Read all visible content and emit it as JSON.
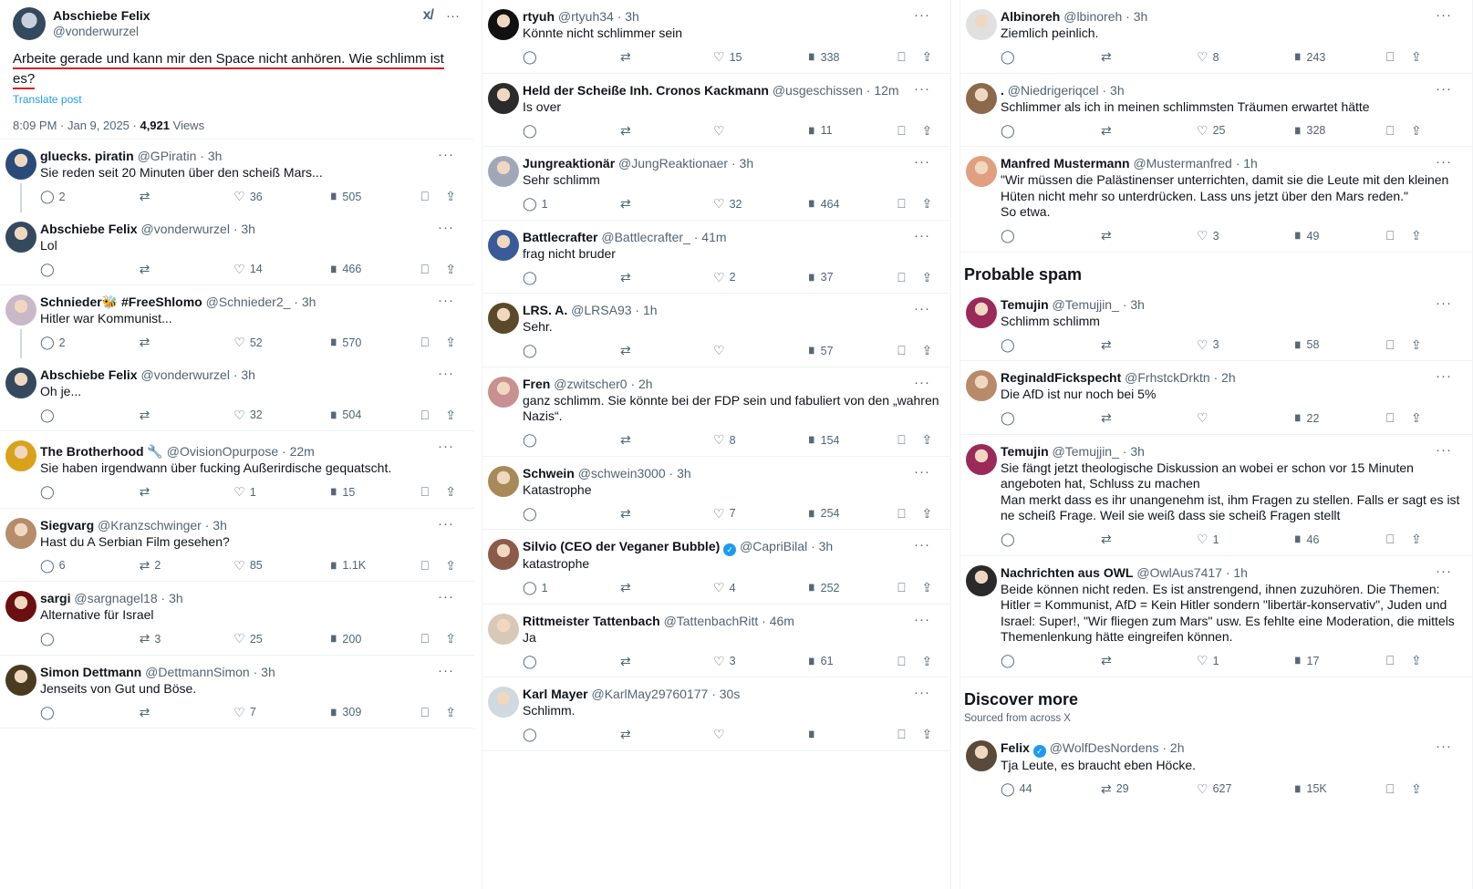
{
  "main_post": {
    "name": "Abschiebe Felix",
    "handle": "@vonderwurzel",
    "text": "Arbeite gerade und kann mir den Space nicht anhören. Wie schlimm ist es?",
    "translate": "Translate post",
    "time": "8:09 PM · Jan 9, 2025 · ",
    "views": "4,921",
    "views_label": " Views",
    "grok_icon": "x-ai-icon",
    "more_icon": "more-dots-icon"
  },
  "columns": [
    [
      {
        "name": "gluecks. piratin",
        "handle": "@GPiratin · 3h",
        "text": "Sie reden seit 20 Minuten über den scheiß Mars...",
        "replies": "2",
        "reposts": "",
        "likes": "36",
        "views": "505",
        "color": "#2a4a7a",
        "thread": "start"
      },
      {
        "name": "Abschiebe Felix",
        "handle": "@vonderwurzel · 3h",
        "text": "Lol",
        "replies": "",
        "reposts": "",
        "likes": "14",
        "views": "466",
        "color": "#34495e",
        "thread": "end",
        "sep": true
      },
      {
        "name": "Schnieder🐝 #FreeShlomo",
        "handle": "@Schnieder2_ · 3h",
        "text": "Hitler war Kommunist...",
        "replies": "2",
        "reposts": "",
        "likes": "52",
        "views": "570",
        "color": "#c8b8c8",
        "thread": "start"
      },
      {
        "name": "Abschiebe Felix",
        "handle": "@vonderwurzel · 3h",
        "text": "Oh je...",
        "replies": "",
        "reposts": "",
        "likes": "32",
        "views": "504",
        "color": "#34495e",
        "thread": "end",
        "sep": true
      },
      {
        "name": "The Brotherhood 🔧",
        "handle": "@OvisionOpurpose · 22m",
        "text": "Sie haben irgendwann über fucking Außerirdische gequatscht.",
        "replies": "",
        "reposts": "",
        "likes": "1",
        "views": "15",
        "color": "#d9a21b",
        "sep": true,
        "pad": 40
      },
      {
        "name": "Siegvarg",
        "handle": "@Kranzschwinger · 3h",
        "text": "Hast du A Serbian Film gesehen?",
        "replies": "6",
        "reposts": "2",
        "likes": "85",
        "views": "1.1K",
        "color": "#b58c6c",
        "sep": true
      },
      {
        "name": "sargi",
        "handle": "@sargnagel18 · 3h",
        "text": "Alternative für Israel",
        "replies": "",
        "reposts": "3",
        "likes": "25",
        "views": "200",
        "color": "#6a1010",
        "sep": true
      },
      {
        "name": "Simon Dettmann",
        "handle": "@DettmannSimon · 3h",
        "text": "Jenseits von Gut und Böse.",
        "replies": "",
        "reposts": "",
        "likes": "7",
        "views": "309",
        "color": "#4a3a20",
        "sep": true
      }
    ],
    [
      {
        "name": "rtyuh",
        "handle": "@rtyuh34 · 3h",
        "text": "Könnte nicht schlimmer sein",
        "replies": "",
        "reposts": "",
        "likes": "15",
        "views": "338",
        "color": "#111111",
        "sep": true
      },
      {
        "name": "Held der Scheiße Inh. Cronos Kackmann",
        "handle": "@usgeschissen · 12m",
        "text": "Is over",
        "replies": "",
        "reposts": "",
        "likes": "",
        "views": "11",
        "color": "#2b2b2b",
        "sep": true
      },
      {
        "name": "Jungreaktionär",
        "handle": "@JungReaktionaer · 3h",
        "text": "Sehr schlimm",
        "replies": "1",
        "reposts": "",
        "likes": "32",
        "views": "464",
        "color": "#a0a8b8",
        "sep": true
      },
      {
        "name": "Battlecrafter",
        "handle": "@Battlecrafter_ · 41m",
        "text": "frag nicht bruder",
        "replies": "",
        "reposts": "",
        "likes": "2",
        "views": "37",
        "color": "#3a5a9a",
        "sep": true
      },
      {
        "name": "LRS. A.",
        "handle": "@LRSA93 · 1h",
        "text": "Sehr.",
        "replies": "",
        "reposts": "",
        "likes": "",
        "views": "57",
        "color": "#5a4a2a",
        "sep": true
      },
      {
        "name": "Fren",
        "handle": "@zwitscher0 · 2h",
        "text": "ganz schlimm. Sie könnte bei der FDP sein und fabuliert von den „wahren Nazis“.",
        "replies": "",
        "reposts": "",
        "likes": "8",
        "views": "154",
        "color": "#c89090",
        "sep": true
      },
      {
        "name": "Schwein",
        "handle": "@schwein3000 · 3h",
        "text": "Katastrophe",
        "replies": "",
        "reposts": "",
        "likes": "7",
        "views": "254",
        "color": "#a88a5a",
        "sep": true
      },
      {
        "name": "Silvio (CEO der Veganer Bubble)",
        "handle": "@CapriBilal · 3h",
        "text": "katastrophe",
        "replies": "1",
        "reposts": "",
        "likes": "4",
        "views": "252",
        "color": "#8a5a4a",
        "verified": true,
        "sep": true
      },
      {
        "name": "Rittmeister Tattenbach",
        "handle": "@TattenbachRitt · 46m",
        "text": "Ja",
        "replies": "",
        "reposts": "",
        "likes": "3",
        "views": "61",
        "color": "#d8c8b8",
        "sep": true
      },
      {
        "name": "Karl Mayer",
        "handle": "@KarlMay29760177 · 30s",
        "text": "Schlimm.",
        "replies": "",
        "reposts": "",
        "likes": "",
        "views": "",
        "color": "#d0d8e0",
        "sep": true
      }
    ],
    [
      {
        "name": "Albinoreh",
        "handle": "@lbinoreh · 3h",
        "text": "Ziemlich peinlich.",
        "replies": "",
        "reposts": "",
        "likes": "8",
        "views": "243",
        "color": "#e0e0e0",
        "sep": true
      },
      {
        "name": ".",
        "handle": "@Niedrigeriqcel · 3h",
        "text": "Schlimmer als ich in meinen schlimmsten Träumen erwartet hätte",
        "replies": "",
        "reposts": "",
        "likes": "25",
        "views": "328",
        "color": "#8a6a4a",
        "sep": true
      },
      {
        "name": "Manfred Mustermann",
        "handle": "@Mustermanfred · 1h",
        "text": "\"Wir müssen die Palästinenser unterrichten, damit sie die Leute mit den kleinen Hüten nicht mehr so unterdrücken. Lass uns jetzt über den Mars reden.\"\nSo etwa.",
        "replies": "",
        "reposts": "",
        "likes": "3",
        "views": "49",
        "color": "#e0a080",
        "sep": true
      },
      {
        "section": "Probable spam"
      },
      {
        "name": "Temujin",
        "handle": "@Temujjin_ · 3h",
        "text": "Schlimm schlimm",
        "replies": "",
        "reposts": "",
        "likes": "3",
        "views": "58",
        "color": "#9a2a5a",
        "sep": true
      },
      {
        "name": "ReginaldFickspecht",
        "handle": "@FrhstckDrktn · 2h",
        "text": "Die AfD ist nur noch bei 5%",
        "replies": "",
        "reposts": "",
        "likes": "",
        "views": "22",
        "color": "#b88a6a",
        "sep": true
      },
      {
        "name": "Temujin",
        "handle": "@Temujjin_ · 3h",
        "text": "Sie fängt jetzt theologische Diskussion an wobei er schon vor 15 Minuten angeboten hat, Schluss zu machen\nMan merkt dass es ihr unangenehm ist, ihm Fragen zu stellen. Falls er sagt es ist ne scheiß Frage. Weil sie weiß dass sie scheiß Fragen stellt",
        "replies": "",
        "reposts": "",
        "likes": "1",
        "views": "46",
        "color": "#9a2a5a",
        "sep": true
      },
      {
        "name": "Nachrichten aus OWL",
        "handle": "@OwlAus7417 · 1h",
        "text": "Beide können nicht reden. Es ist anstrengend, ihnen zuzuhören. Die Themen: Hitler = Kommunist, AfD = Kein Hitler sondern \"libertär-konservativ\", Juden und Israel: Super!, \"Wir fliegen zum Mars\" usw. Es fehlte eine Moderation, die mittels Themenlenkung hätte eingreifen können.",
        "replies": "",
        "reposts": "",
        "likes": "1",
        "views": "17",
        "color": "#2a2a2a",
        "sep": true
      },
      {
        "section": "Discover more",
        "sub": "Sourced from across X"
      },
      {
        "name": "Felix",
        "handle": "@WolfDesNordens · 2h",
        "text": "Tja Leute, es braucht eben Höcke.",
        "replies": "44",
        "reposts": "29",
        "likes": "627",
        "views": "15K",
        "color": "#5a4a3a",
        "verified": true
      }
    ]
  ],
  "icons": {
    "reply": "reply-bubble-icon",
    "repost": "repost-icon",
    "like": "heart-icon",
    "views": "views-bars-icon",
    "bookmark": "bookmark-icon",
    "share": "share-icon"
  },
  "colors": {
    "accent": "#1d9bf0",
    "text": "#0f1419",
    "muted": "#536471",
    "underline": "#d4202a"
  }
}
